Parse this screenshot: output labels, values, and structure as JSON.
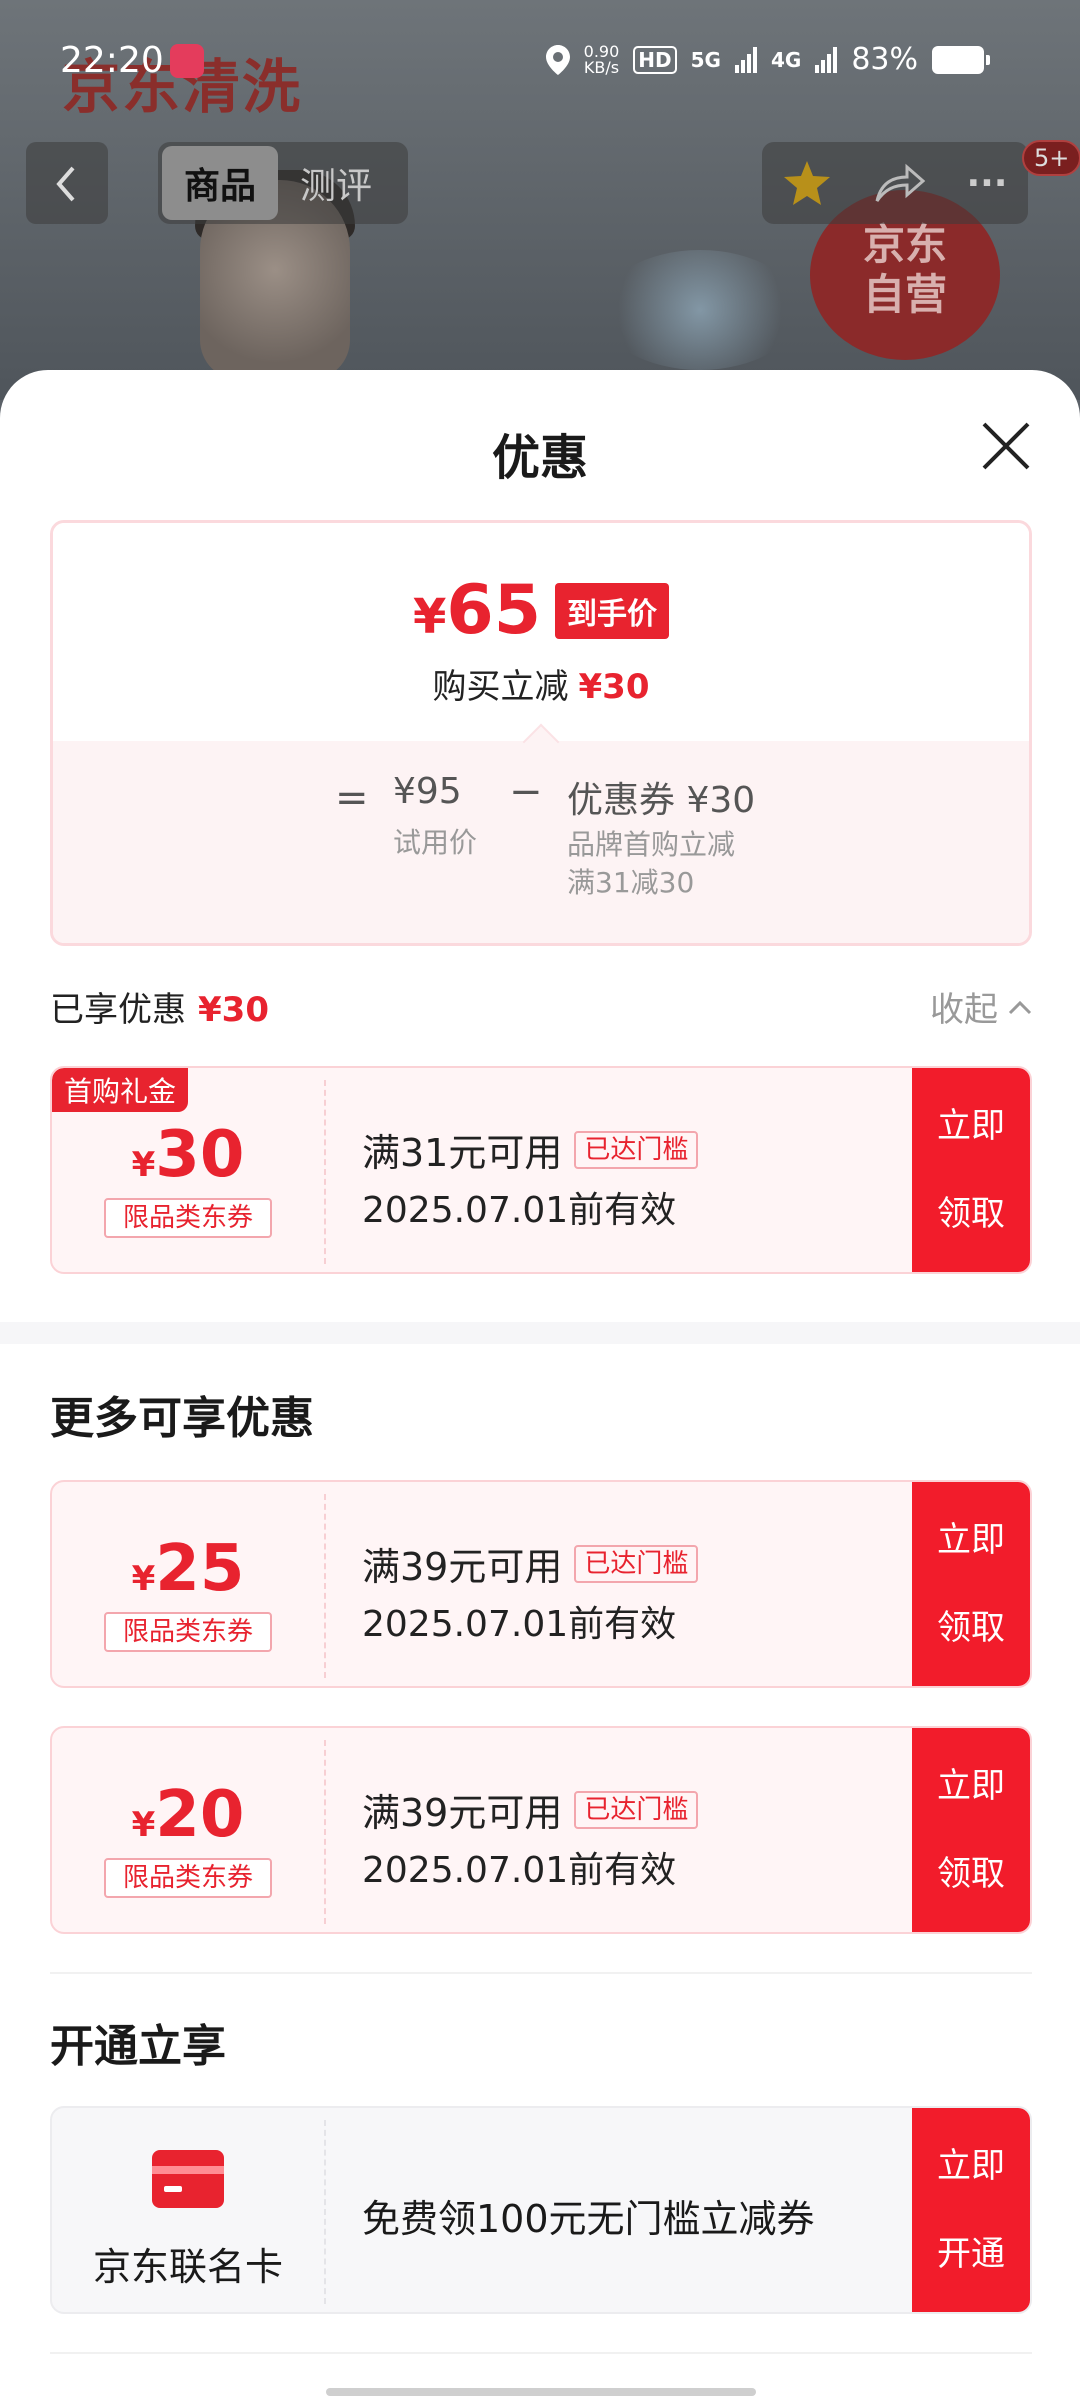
{
  "status_bar": {
    "time": "22:20",
    "net_speed_value": "0.90",
    "net_speed_unit": "KB/s",
    "hd": "HD",
    "net_5g": "5G",
    "net_4g": "4G",
    "battery": "83%"
  },
  "background": {
    "brand": "京东清洗",
    "seal_line1": "京东",
    "seal_line2": "自营"
  },
  "nav": {
    "tabs": [
      {
        "label": "商品",
        "active": true
      },
      {
        "label": "测评",
        "active": false
      }
    ],
    "badge": "5+",
    "more": "···"
  },
  "sheet": {
    "title": "优惠",
    "price_card": {
      "currency": "¥",
      "final_price": "65",
      "final_label": "到手价",
      "reduce_label": "购买立减",
      "reduce_amount": "¥30",
      "eq": "=",
      "minus": "−",
      "base_price": "¥95",
      "base_label": "试用价",
      "coupon_text": "优惠券 ¥30",
      "coupon_desc1": "品牌首购立减",
      "coupon_desc2": "满31减30"
    },
    "enjoyed": {
      "label": "已享优惠",
      "amount": "¥30",
      "collapse": "收起"
    },
    "enjoyed_coupons": [
      {
        "ribbon": "首购礼金",
        "currency": "¥",
        "amount": "30",
        "type": "限品类东券",
        "condition": "满31元可用",
        "reached": "已达门槛",
        "valid": "2025.07.01前有效",
        "button_l1": "立即",
        "button_l2": "领取"
      }
    ],
    "more_title": "更多可享优惠",
    "more_coupons": [
      {
        "currency": "¥",
        "amount": "25",
        "type": "限品类东券",
        "condition": "满39元可用",
        "reached": "已达门槛",
        "valid": "2025.07.01前有效",
        "button_l1": "立即",
        "button_l2": "领取"
      },
      {
        "currency": "¥",
        "amount": "20",
        "type": "限品类东券",
        "condition": "满39元可用",
        "reached": "已达门槛",
        "valid": "2025.07.01前有效",
        "button_l1": "立即",
        "button_l2": "领取"
      }
    ],
    "open_title": "开通立享",
    "open_card": {
      "name": "京东联名卡",
      "offer": "免费领100元无门槛立减券",
      "button_l1": "立即",
      "button_l2": "开通"
    }
  },
  "colors": {
    "accent": "#e8232f",
    "button": "#f21c2b",
    "coupon_bg": "#fff5f6"
  }
}
